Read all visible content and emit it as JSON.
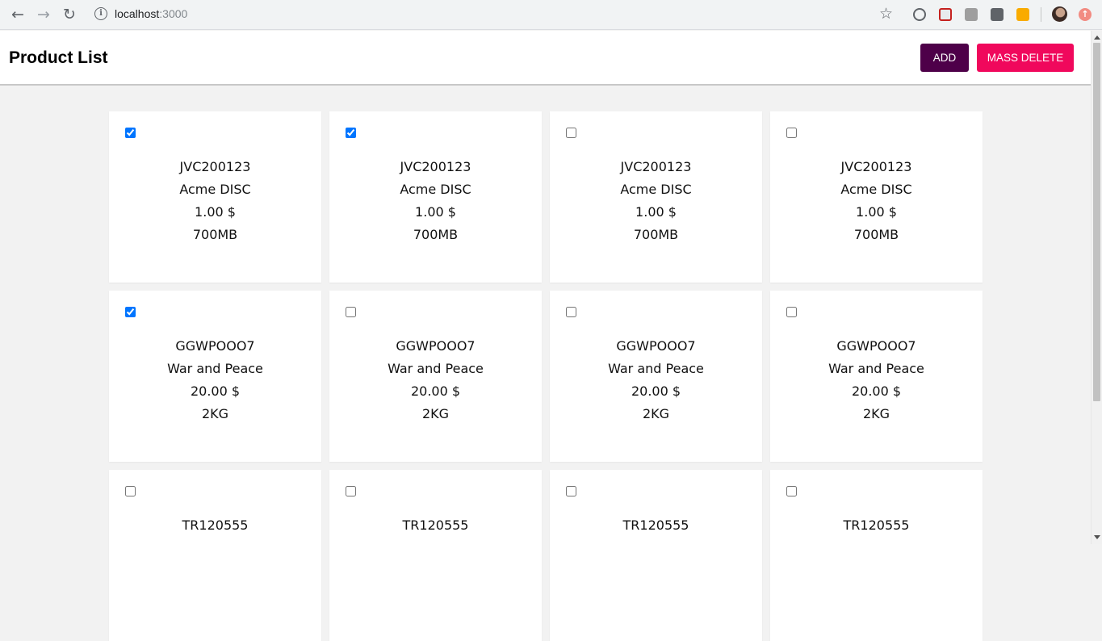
{
  "browser": {
    "url_host": "localhost",
    "url_port": ":3000"
  },
  "header": {
    "title": "Product List",
    "add_label": "ADD",
    "mass_delete_label": "MASS DELETE",
    "colors": {
      "add": "#4e0049",
      "mass_delete": "#f0085c"
    }
  },
  "products": [
    {
      "sku": "JVC200123",
      "name": "Acme DISC",
      "price": "1.00 $",
      "attribute": "700MB",
      "checked": true
    },
    {
      "sku": "JVC200123",
      "name": "Acme DISC",
      "price": "1.00 $",
      "attribute": "700MB",
      "checked": true
    },
    {
      "sku": "JVC200123",
      "name": "Acme DISC",
      "price": "1.00 $",
      "attribute": "700MB",
      "checked": false
    },
    {
      "sku": "JVC200123",
      "name": "Acme DISC",
      "price": "1.00 $",
      "attribute": "700MB",
      "checked": false
    },
    {
      "sku": "GGWPOOO7",
      "name": "War and Peace",
      "price": "20.00 $",
      "attribute": "2KG",
      "checked": true
    },
    {
      "sku": "GGWPOOO7",
      "name": "War and Peace",
      "price": "20.00 $",
      "attribute": "2KG",
      "checked": false
    },
    {
      "sku": "GGWPOOO7",
      "name": "War and Peace",
      "price": "20.00 $",
      "attribute": "2KG",
      "checked": false
    },
    {
      "sku": "GGWPOOO7",
      "name": "War and Peace",
      "price": "20.00 $",
      "attribute": "2KG",
      "checked": false
    },
    {
      "sku": "TR120555",
      "checked": false
    },
    {
      "sku": "TR120555",
      "checked": false
    },
    {
      "sku": "TR120555",
      "checked": false
    },
    {
      "sku": "TR120555",
      "checked": false
    }
  ]
}
